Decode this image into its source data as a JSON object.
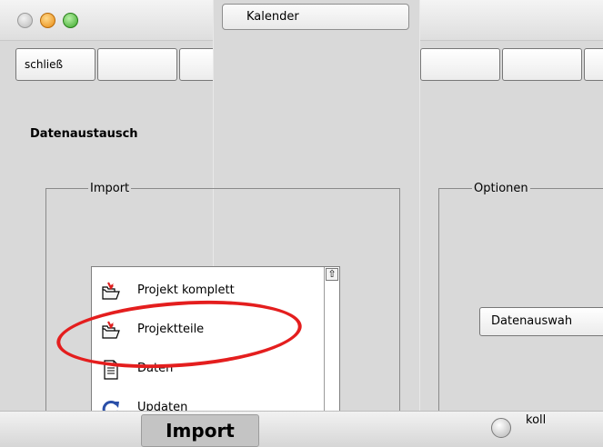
{
  "window": {
    "calendar_button": "Kalender",
    "toolbar_buttons": [
      "schließ",
      "",
      "",
      "",
      "",
      ""
    ]
  },
  "page": {
    "title": "Datenaustausch"
  },
  "import_group": {
    "legend": "Import",
    "items": [
      {
        "label": "Projekt komplett",
        "icon": "folder-import-icon"
      },
      {
        "label": "Projektteile",
        "icon": "folder-import-icon"
      },
      {
        "label": "Daten",
        "icon": "document-icon"
      },
      {
        "label": "Updaten",
        "icon": "refresh-icon"
      }
    ]
  },
  "options_group": {
    "legend": "Optionen",
    "select_label": "Datenauswah",
    "protocol_label": "koll"
  },
  "bottom": {
    "active_tab": "Import"
  },
  "colors": {
    "highlight_ellipse": "#e41e1e",
    "background": "#d9d9d9"
  }
}
